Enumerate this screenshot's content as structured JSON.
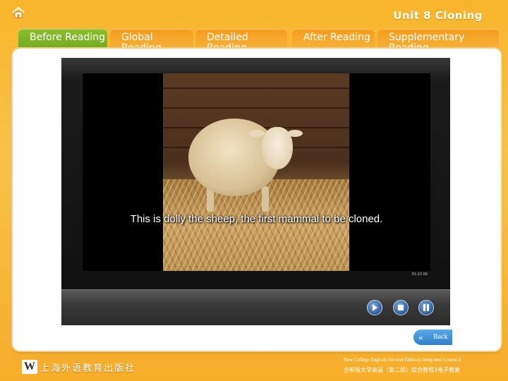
{
  "header": {
    "home_icon": "home-icon",
    "unit_title": "Unit 8 Cloning"
  },
  "tabs": [
    {
      "label": "Before Reading",
      "active": true
    },
    {
      "label": "Global Reading",
      "active": false
    },
    {
      "label": "Detailed Reading",
      "active": false
    },
    {
      "label": "After Reading",
      "active": false
    },
    {
      "label": "Supplementary Reading",
      "active": false
    }
  ],
  "video": {
    "subtitle": "This is dolly the sheep, the first mammal to be cloned.",
    "corner_text": "01:23 00",
    "controls": {
      "play": "play-icon",
      "stop": "stop-icon",
      "pause": "pause-icon"
    }
  },
  "back_button": {
    "label": "Back",
    "icon": "double-chevron-left-icon"
  },
  "footer": {
    "publisher_logo_letter": "W",
    "publisher_name": "上海外语教育出版社",
    "course_en": "New College English (Second Edition) Integrated Course 3",
    "course_cn": "全新版大学英语（第二版）综合教程3电子教案"
  },
  "colors": {
    "background": "#f7b52b",
    "tab_active": "#7ab226",
    "tab_inactive": "#f7a92f",
    "control_blue": "#2d5d9a",
    "back_button": "#3a8ad6"
  }
}
